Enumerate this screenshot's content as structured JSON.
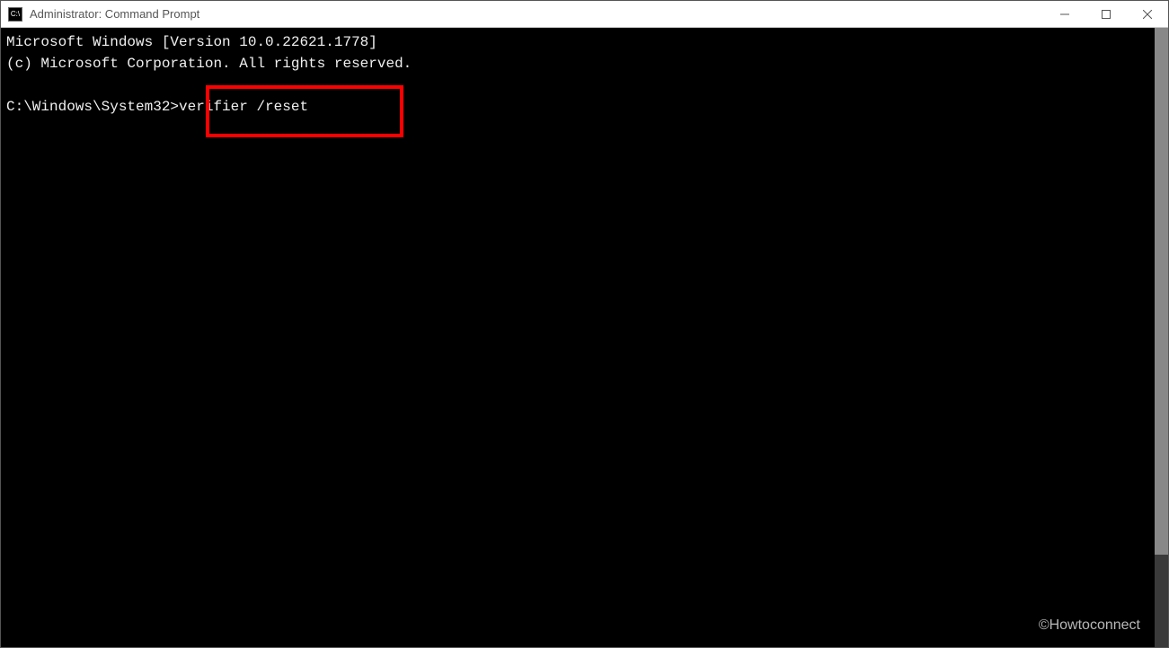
{
  "titlebar": {
    "icon_text": "C:\\",
    "title": "Administrator: Command Prompt"
  },
  "window_controls": {
    "minimize_label": "—",
    "maximize_label": "☐",
    "close_label": "✕"
  },
  "terminal": {
    "line1": "Microsoft Windows [Version 10.0.22621.1778]",
    "line2": "(c) Microsoft Corporation. All rights reserved.",
    "blank": "",
    "prompt": "C:\\Windows\\System32>",
    "command": "verifier /reset"
  },
  "watermark": "©Howtoconnect"
}
